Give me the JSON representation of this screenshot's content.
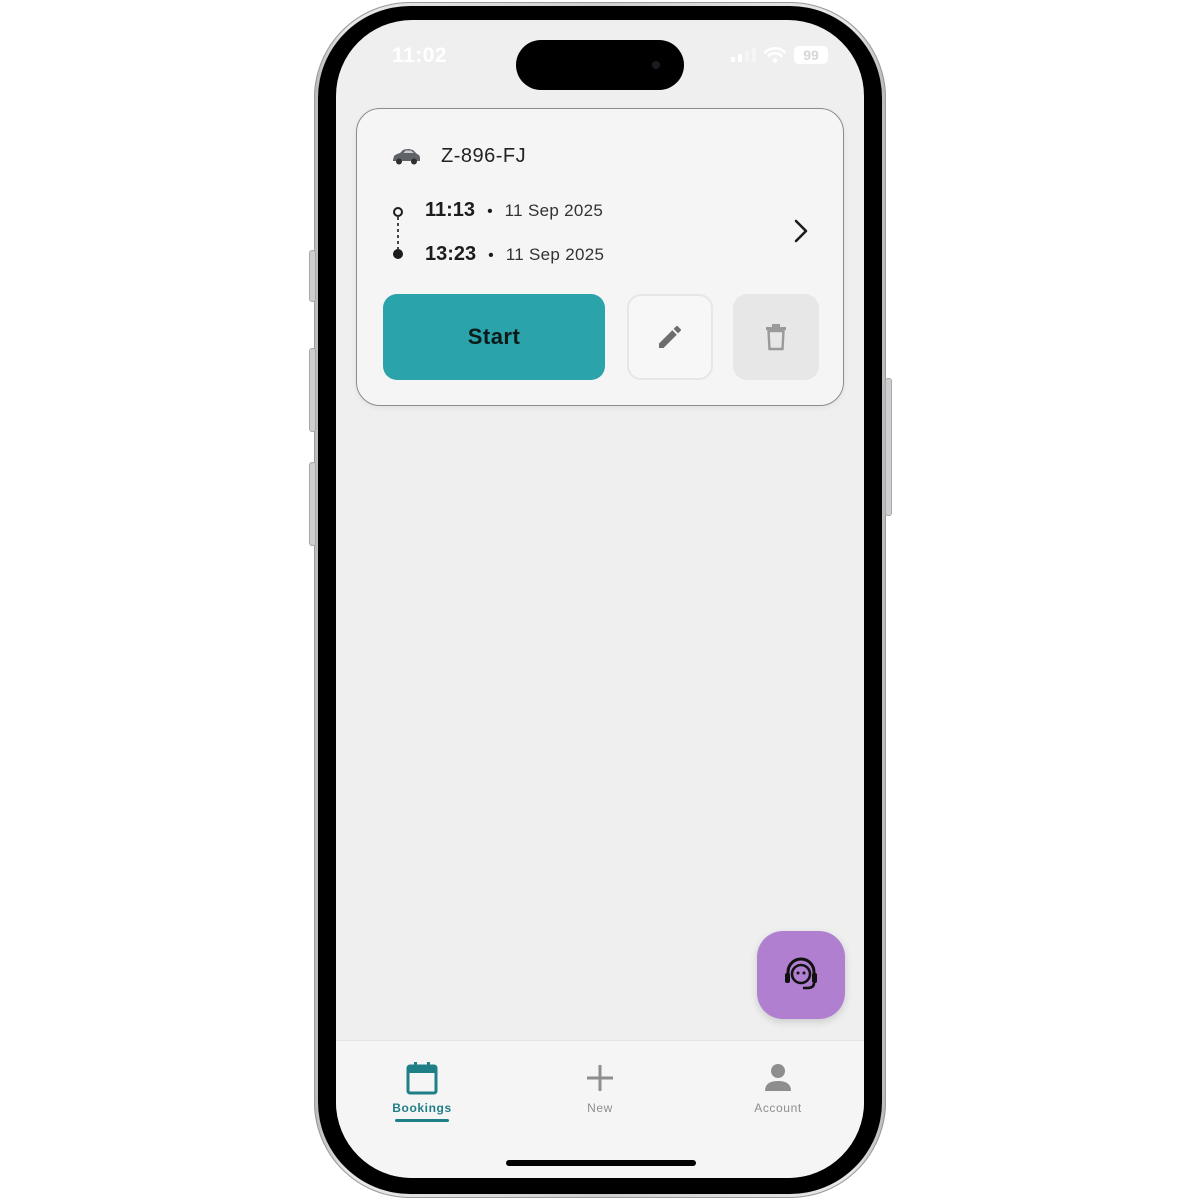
{
  "status_bar": {
    "time": "11:02",
    "battery": "99"
  },
  "booking": {
    "plate": "Z-896-FJ",
    "vehicle_icon": "car-icon",
    "start_time": "11:13",
    "start_date": "11 Sep 2025",
    "end_time": "13:23",
    "end_date": "11 Sep 2025",
    "separator": "•",
    "start_label": "Start",
    "edit_icon": "pencil-icon",
    "delete_icon": "trash-icon"
  },
  "fab": {
    "icon": "headset-support-icon"
  },
  "nav": {
    "items": [
      {
        "label": "Bookings",
        "icon": "calendar-icon",
        "active": true
      },
      {
        "label": "New",
        "icon": "plus-icon",
        "active": false
      },
      {
        "label": "Account",
        "icon": "person-icon",
        "active": false
      }
    ]
  },
  "colors": {
    "accent": "#2aa3aa",
    "nav_active": "#1f7f86",
    "fab": "#b07fd0",
    "background": "#efefef"
  }
}
